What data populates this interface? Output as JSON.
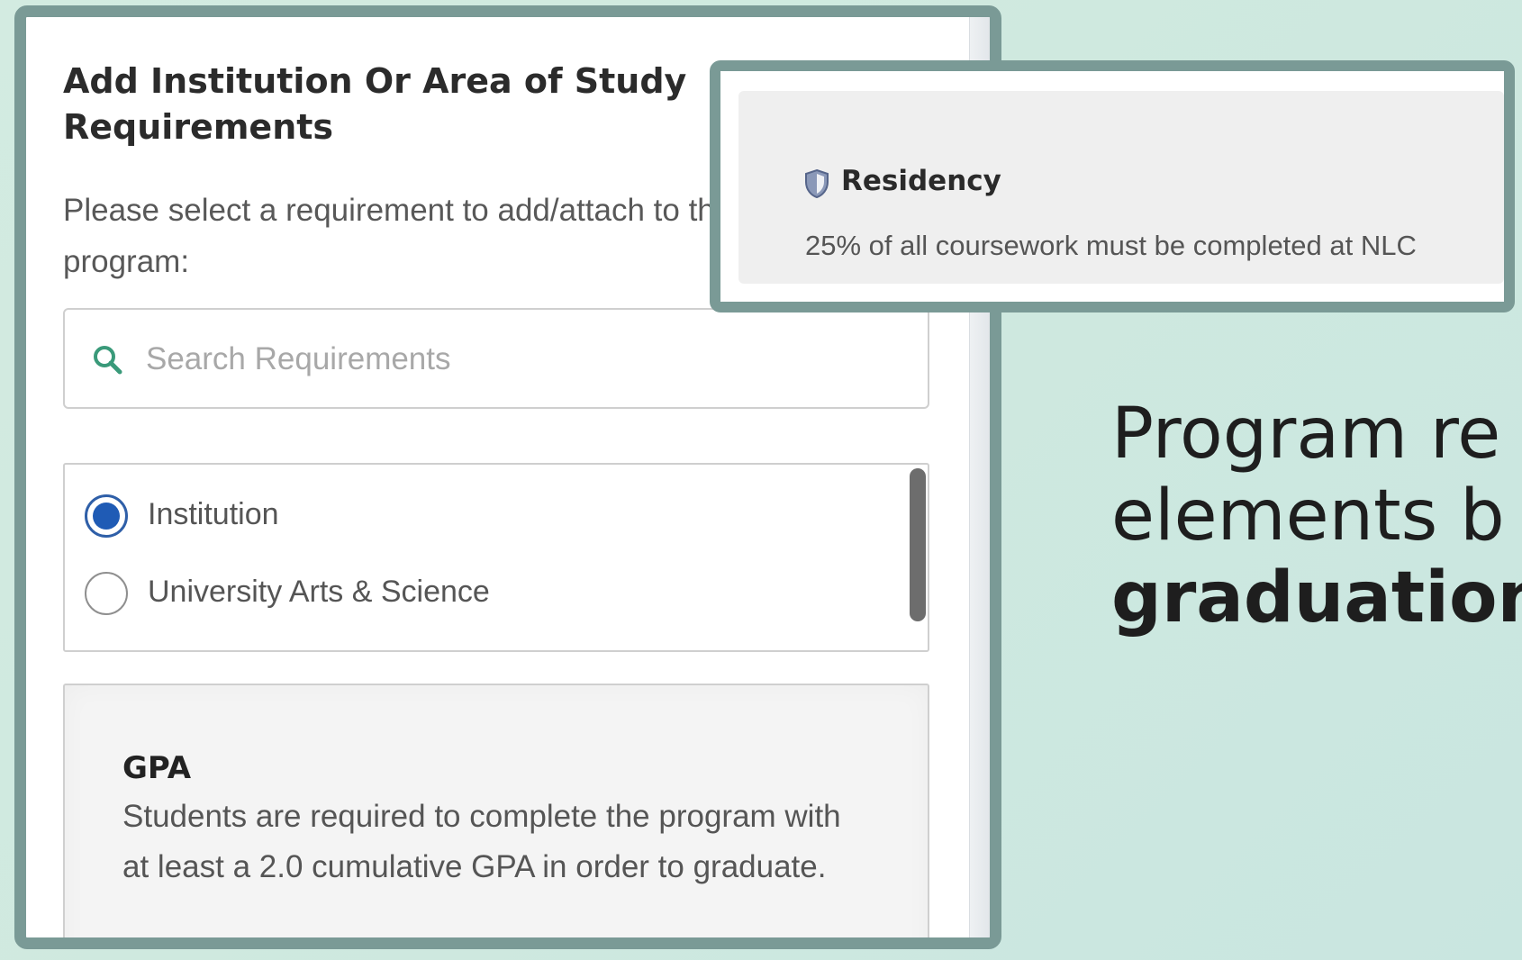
{
  "dialog": {
    "title_line1": "Add Institution Or Area of Study",
    "title_line2": "Requirements",
    "instruction_line1": "Please select a requirement to add/attach to this",
    "instruction_line2": "program:",
    "search": {
      "placeholder": "Search Requirements",
      "value": ""
    },
    "options": [
      {
        "label": "Institution",
        "selected": true
      },
      {
        "label": "University Arts & Science",
        "selected": false
      }
    ],
    "requirement_card": {
      "title": "GPA",
      "description": "Students are required to complete the program with at least a 2.0 cumulative GPA in order to graduate."
    }
  },
  "popup": {
    "icon": "shield-icon",
    "title": "Residency",
    "description": "25% of all coursework must be completed at NLC"
  },
  "headline": {
    "line1": "Program re",
    "line2": "elements b",
    "line3": "graduation"
  },
  "colors": {
    "frame": "#7a9a96",
    "background": "#d3ebe1",
    "radio_selected": "#1f5bb5",
    "search_icon": "#3a9a7a"
  }
}
